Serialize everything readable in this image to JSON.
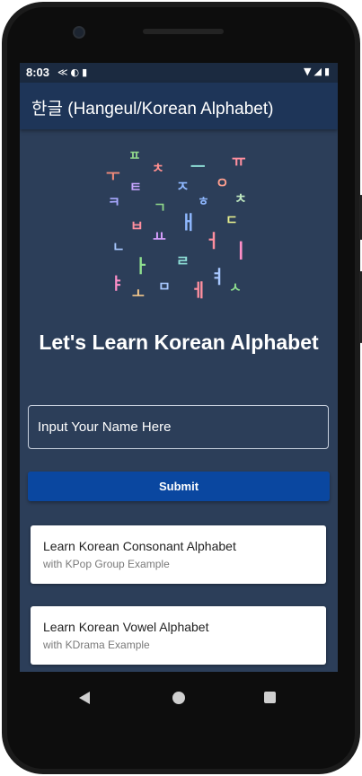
{
  "statusbar": {
    "time": "8:03",
    "left_icons": [
      "flutter-icon",
      "data-saver-icon",
      "sd-card-icon"
    ],
    "right_icons": [
      "wifi-icon",
      "cellular-signal-icon",
      "battery-icon"
    ]
  },
  "appbar": {
    "title": "한글 (Hangeul/Korean Alphabet)"
  },
  "hero": {
    "letters": [
      {
        "char": "ㅍ",
        "color": "#8fd68a"
      },
      {
        "char": "ㅜ",
        "color": "#f08a7a"
      },
      {
        "char": "ㅊ",
        "color": "#ff8f8f"
      },
      {
        "char": "ㅡ",
        "color": "#8fe0d8"
      },
      {
        "char": "ㅠ",
        "color": "#ff8f9f"
      },
      {
        "char": "ㅌ",
        "color": "#c7a5ff"
      },
      {
        "char": "ㅈ",
        "color": "#8fb8ff"
      },
      {
        "char": "ㅇ",
        "color": "#ff9f8f"
      },
      {
        "char": "ㅋ",
        "color": "#a8a8ff"
      },
      {
        "char": "ㄱ",
        "color": "#8fd68a"
      },
      {
        "char": "ㅎ",
        "color": "#8fb8ff"
      },
      {
        "char": "ㅊ",
        "color": "#bfe8c0"
      },
      {
        "char": "ㅂ",
        "color": "#ff8f9f"
      },
      {
        "char": "ㅛ",
        "color": "#d8a0ff"
      },
      {
        "char": "ㅐ",
        "color": "#8fb8ff"
      },
      {
        "char": "ㄷ",
        "color": "#e8f08f"
      },
      {
        "char": "ㄴ",
        "color": "#a8c8ff"
      },
      {
        "char": "ㅓ",
        "color": "#ff8f9f"
      },
      {
        "char": "ㅣ",
        "color": "#ff8fc8"
      },
      {
        "char": "ㅏ",
        "color": "#8fe08f"
      },
      {
        "char": "ㄹ",
        "color": "#8fe0d8"
      },
      {
        "char": "ㅕ",
        "color": "#a8c8ff"
      },
      {
        "char": "ㅑ",
        "color": "#ff8fc8"
      },
      {
        "char": "ㅗ",
        "color": "#ffcf8f"
      },
      {
        "char": "ㅁ",
        "color": "#a8c8ff"
      },
      {
        "char": "ㅔ",
        "color": "#ff8f9f"
      },
      {
        "char": "ㅅ",
        "color": "#8fe08f"
      }
    ],
    "headline": "Let's Learn Korean Alphabet"
  },
  "form": {
    "name_placeholder": "Input Your Name Here",
    "submit_label": "Submit"
  },
  "cards": [
    {
      "title": "Learn Korean Consonant Alphabet",
      "subtitle": "with KPop Group Example"
    },
    {
      "title": "Learn Korean Vowel Alphabet",
      "subtitle": "with KDrama Example"
    }
  ],
  "colors": {
    "background": "#2c3e59",
    "appbar": "#1e3558",
    "submit": "#0a47a0"
  }
}
